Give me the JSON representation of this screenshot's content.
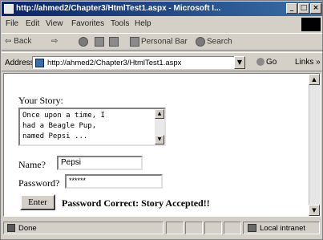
{
  "window": {
    "title": "http://ahmed2/Chapter3/HtmlTest1.aspx - Microsoft I...",
    "minimize": "_",
    "maximize": "□",
    "close": "×"
  },
  "menu": {
    "items": [
      "File",
      "Edit",
      "View",
      "Favorites",
      "Tools",
      "Help"
    ]
  },
  "toolbar": {
    "back": "⇦ Back",
    "forward": "⇨",
    "personal_bar": "Personal Bar",
    "search": "Search"
  },
  "address": {
    "label": "Address",
    "value": "http://ahmed2/Chapter3/HtmlTest1.aspx",
    "go": "Go",
    "links": "Links »"
  },
  "form": {
    "story_label": "Your Story:",
    "story_value": "Once upon a time, I\nhad a Beagle Pup,\nnamed Pepsi ...",
    "name_label": "Name?",
    "name_value": "Pepsi",
    "password_label": "Password?",
    "password_value": "******",
    "enter_button": "Enter",
    "result": "Password Correct: Story Accepted!!"
  },
  "status": {
    "text": "Done",
    "zone": "Local intranet"
  }
}
